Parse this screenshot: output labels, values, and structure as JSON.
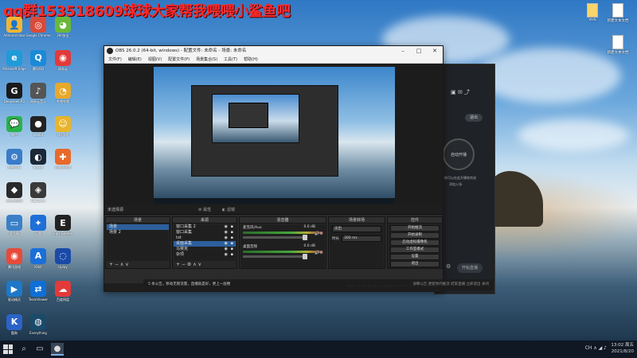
{
  "overlay": {
    "text": "qq群153518609球球大家帮我喂喂小鲨鱼吧"
  },
  "desktop": {
    "icons_col1": [
      {
        "name": "Administrator",
        "color": "#f3b634",
        "glyph": "👤"
      },
      {
        "name": "Microsoft Edge",
        "color": "#1f9bd8",
        "glyph": "e"
      },
      {
        "name": "Deepseek-R1",
        "color": "#1a1a1a",
        "glyph": "G"
      },
      {
        "name": "微信",
        "color": "#2ab24a",
        "glyph": "💬"
      },
      {
        "name": "控制面板",
        "color": "#3a7cc8",
        "glyph": "⚙"
      },
      {
        "name": "游戏加速器",
        "color": "#2a2a2a",
        "glyph": "◆"
      },
      {
        "name": "此电脑",
        "color": "#3a80c8",
        "glyph": "▭"
      },
      {
        "name": "腾讯游戏",
        "color": "#e64a3a",
        "glyph": "◉"
      },
      {
        "name": "驱动精灵",
        "color": "#1e78c8",
        "glyph": "▶"
      },
      {
        "name": "酷狗",
        "color": "#2a63c8",
        "glyph": "K"
      }
    ],
    "icons_col2": [
      {
        "name": "Google Chrome",
        "color": "#d84a3a",
        "glyph": "◎"
      },
      {
        "name": "腾讯QQ",
        "color": "#1a8ad8",
        "glyph": "Q"
      },
      {
        "name": "网易云音乐",
        "color": "#555",
        "glyph": "♪"
      },
      {
        "name": "obs64",
        "color": "#222",
        "glyph": "●"
      },
      {
        "name": "Steam",
        "color": "#1b2838",
        "glyph": "◐"
      },
      {
        "name": "WeGame",
        "color": "#3a3a3a",
        "glyph": "◈"
      },
      {
        "name": "迅雷",
        "color": "#1e6fd8",
        "glyph": "✦"
      },
      {
        "name": "IObit",
        "color": "#1a6fd8",
        "glyph": "A"
      },
      {
        "name": "TeamViewer",
        "color": "#0e6fd8",
        "glyph": "⇄"
      },
      {
        "name": "Everything",
        "color": "#1a4a6a",
        "glyph": "◍"
      }
    ],
    "icons_col3": [
      {
        "name": "360安全",
        "color": "#6ab83a",
        "glyph": "◕"
      },
      {
        "name": "网易云",
        "color": "#e23a3a",
        "glyph": "◉"
      },
      {
        "name": "哔哩哔哩",
        "color": "#e8a92a",
        "glyph": "◔"
      },
      {
        "name": "QQ游戏",
        "color": "#e8b42a",
        "glyph": "☺"
      },
      {
        "name": "迅雷极速版",
        "color": "#e86a2a",
        "glyph": "✚"
      },
      {
        "name": "Epic Games",
        "color": "#222",
        "glyph": "E"
      },
      {
        "name": "Uplay",
        "color": "#1a4aa8",
        "glyph": "◌"
      },
      {
        "name": "百度网盘",
        "color": "#e23a3a",
        "glyph": "☁"
      }
    ],
    "right_files": [
      {
        "name": "VHS"
      },
      {
        "name": "新建文本文档"
      },
      {
        "name": "新建文本文档"
      }
    ]
  },
  "darkapp": {
    "pill": "退出",
    "circle": "自动开播",
    "line1": "你可以在此开播和完成",
    "line2": "添加入场",
    "button": "开始直播"
  },
  "obs": {
    "title": "OBS 26.0.2 (64-bit, windows) - 配置文件: 未命名 - 场景: 未命名",
    "menu": [
      "文件(F)",
      "编辑(E)",
      "视图(V)",
      "配置文件(P)",
      "场景集合(S)",
      "工具(T)",
      "帮助(H)"
    ],
    "context_label": "未选择源",
    "props_label": "属性",
    "filters_label": "滤镜",
    "docks": {
      "scenes": {
        "title": "场景",
        "items": [
          "场景",
          "场景 2"
        ],
        "selected": 0
      },
      "sources": {
        "title": "来源",
        "items": [
          "窗口采集 2",
          "窗口采集",
          "txt",
          "桌面采集",
          "马赛克",
          "杂项"
        ],
        "selected": 3
      },
      "mixer": {
        "title": "混音器",
        "channels": [
          {
            "name": "麦克风/Aux",
            "db": "0.0 dB"
          },
          {
            "name": "桌面音频",
            "db": "0.0 dB"
          }
        ]
      },
      "transitions": {
        "title": "场景转场",
        "value": "淡出",
        "duration_label": "时长",
        "duration": "300 ms"
      },
      "controls": {
        "title": "控件",
        "buttons": [
          "开始推流",
          "开始录制",
          "启动虚拟摄像机",
          "工作室模式",
          "设置",
          "退出"
        ]
      }
    },
    "status": "LIVE: 00:00:00    REC: 00:00:00    CPU: 2.9%, 60.00 fps"
  },
  "notification": {
    "text": "5 条公告。移动无限流量，直播就是好，更上一层楼",
    "right": "详细公告    更新你的推流    结束直播    立即退出    关闭"
  },
  "taskbar": {
    "time": "13:02 周五",
    "date": "2021/8/20",
    "tray": "CH  ∧  ◢  ♪"
  }
}
